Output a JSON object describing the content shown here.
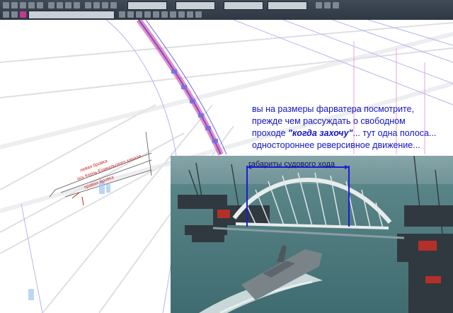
{
  "commentary": {
    "line1": "вы на размеры фарватера посмотрите,",
    "line2": "прежде чем рассуждать о свободном",
    "line3_prefix": "проходе ",
    "line3_emph": "\"когда захочу\"",
    "line3_suffix": "... тут одна полоса...",
    "line4": "одностороннее реверсивное движение..."
  },
  "photo": {
    "clearance_label": "габариты судового хода"
  },
  "drawing": {
    "label_left": "левая бровка",
    "label_axis": "ось Керчь-Еникальского канала",
    "label_right": "правая бровка"
  },
  "colors": {
    "commentary_text": "#1313c8",
    "clearance_marker": "#1c1cd8",
    "drawing_labels": "#cc1f1f",
    "toolbar": "#2f3843"
  }
}
